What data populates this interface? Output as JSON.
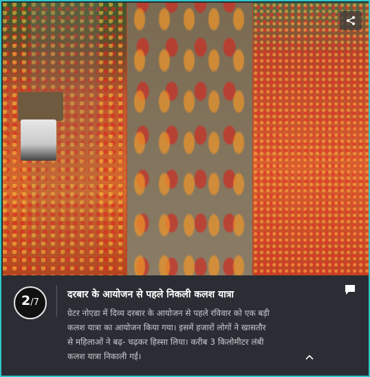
{
  "gallery": {
    "current": "2",
    "total": "/7",
    "title": "दरबार के आयोजन से पहले निकली कलश यात्रा",
    "description": "ग्रेटर नोएडा में दिव्य दरबार के आयोजन से पहले रविवार को एक बड़ी कलश यात्रा का आयोजन किया गया। इसमें हजारों लोगों ने खासतौर से महिलाओं ने बढ़- चढ़कर हिस्सा लिया। करीब 3 किलोमीटर लंबी कलश यात्रा निकाली गई।"
  },
  "icons": {
    "share": "share-icon",
    "comment": "comment-icon",
    "collapse": "chevron-up-icon"
  },
  "colors": {
    "frame_border": "#2ec6c9",
    "caption_bg": "#2a2d33",
    "title": "#ffffff",
    "description": "#c9ccd2"
  }
}
